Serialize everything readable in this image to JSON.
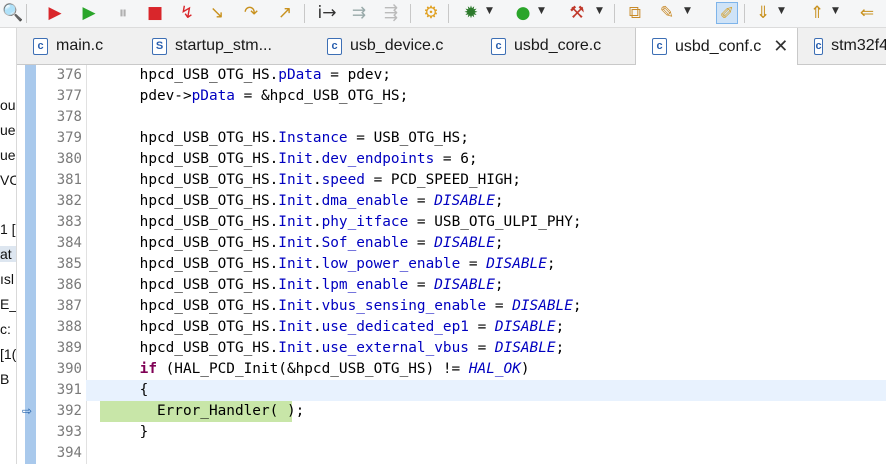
{
  "toolbar": {
    "icons": [
      "search-icon",
      "debug-red-icon",
      "resume-icon",
      "suspend-icon",
      "terminate-icon",
      "disconnect-icon",
      "step-into-icon",
      "step-over-icon",
      "step-return-icon",
      "instruction-step-icon",
      "use-step-filters-icon",
      "skip-breakpoints-icon",
      "build-icon",
      "debug-icon",
      "run-icon",
      "external-tools-icon",
      "open-type-icon",
      "search-tool-icon",
      "toggle-mark-icon",
      "next-annotation-icon",
      "prev-annotation-icon"
    ],
    "colors": {
      "run": "#2aa52a",
      "terminate": "#d9262b",
      "debug": "#2c7a2c"
    }
  },
  "left_strip": {
    "fragments": [
      {
        "text": "ou",
        "selected": false
      },
      {
        "text": "ue",
        "selected": false
      },
      {
        "text": "ue",
        "selected": false
      },
      {
        "text": "VC",
        "selected": false
      },
      {
        "text": "1 [",
        "selected": false
      },
      {
        "text": "at",
        "selected": true
      },
      {
        "text": "ısl",
        "selected": false
      },
      {
        "text": "E_",
        "selected": false
      },
      {
        "text": "c:",
        "selected": false
      },
      {
        "text": "[1(",
        "selected": false
      },
      {
        "text": "B",
        "selected": false
      }
    ]
  },
  "tabs": [
    {
      "label": "main.c",
      "icon": "c",
      "active": false
    },
    {
      "label": "startup_stm...",
      "icon": "S",
      "active": false
    },
    {
      "label": "usb_device.c",
      "icon": "c",
      "active": false
    },
    {
      "label": "usbd_core.c",
      "icon": "c",
      "active": false
    },
    {
      "label": "usbd_conf.c",
      "icon": "c",
      "active": true,
      "close": "✕"
    },
    {
      "label": "stm32f4",
      "icon": "c",
      "active": false
    }
  ],
  "editor": {
    "lines": [
      {
        "n": "376",
        "tokens": [
          [
            "",
            "    hpcd_USB_OTG_HS."
          ],
          [
            "fld",
            "pData"
          ],
          [
            "",
            " = pdev;"
          ]
        ]
      },
      {
        "n": "377",
        "tokens": [
          [
            "",
            "    pdev->"
          ],
          [
            "fld",
            "pData"
          ],
          [
            "",
            " = &hpcd_USB_OTG_HS;"
          ]
        ]
      },
      {
        "n": "378",
        "tokens": []
      },
      {
        "n": "379",
        "tokens": [
          [
            "",
            "    hpcd_USB_OTG_HS."
          ],
          [
            "fld",
            "Instance"
          ],
          [
            "",
            " = USB_OTG_HS;"
          ]
        ]
      },
      {
        "n": "380",
        "tokens": [
          [
            "",
            "    hpcd_USB_OTG_HS."
          ],
          [
            "fld",
            "Init"
          ],
          [
            "",
            "."
          ],
          [
            "fld",
            "dev_endpoints"
          ],
          [
            "",
            " = 6;"
          ]
        ]
      },
      {
        "n": "381",
        "tokens": [
          [
            "",
            "    hpcd_USB_OTG_HS."
          ],
          [
            "fld",
            "Init"
          ],
          [
            "",
            "."
          ],
          [
            "fld",
            "speed"
          ],
          [
            "",
            " = PCD_SPEED_HIGH;"
          ]
        ]
      },
      {
        "n": "382",
        "tokens": [
          [
            "",
            "    hpcd_USB_OTG_HS."
          ],
          [
            "fld",
            "Init"
          ],
          [
            "",
            "."
          ],
          [
            "fld",
            "dma_enable"
          ],
          [
            "",
            " = "
          ],
          [
            "mac",
            "DISABLE"
          ],
          [
            "",
            ";"
          ]
        ]
      },
      {
        "n": "383",
        "tokens": [
          [
            "",
            "    hpcd_USB_OTG_HS."
          ],
          [
            "fld",
            "Init"
          ],
          [
            "",
            "."
          ],
          [
            "fld",
            "phy_itface"
          ],
          [
            "",
            " = USB_OTG_ULPI_PHY;"
          ]
        ]
      },
      {
        "n": "384",
        "tokens": [
          [
            "",
            "    hpcd_USB_OTG_HS."
          ],
          [
            "fld",
            "Init"
          ],
          [
            "",
            "."
          ],
          [
            "fld",
            "Sof_enable"
          ],
          [
            "",
            " = "
          ],
          [
            "mac",
            "DISABLE"
          ],
          [
            "",
            ";"
          ]
        ]
      },
      {
        "n": "385",
        "tokens": [
          [
            "",
            "    hpcd_USB_OTG_HS."
          ],
          [
            "fld",
            "Init"
          ],
          [
            "",
            "."
          ],
          [
            "fld",
            "low_power_enable"
          ],
          [
            "",
            " = "
          ],
          [
            "mac",
            "DISABLE"
          ],
          [
            "",
            ";"
          ]
        ]
      },
      {
        "n": "386",
        "tokens": [
          [
            "",
            "    hpcd_USB_OTG_HS."
          ],
          [
            "fld",
            "Init"
          ],
          [
            "",
            "."
          ],
          [
            "fld",
            "lpm_enable"
          ],
          [
            "",
            " = "
          ],
          [
            "mac",
            "DISABLE"
          ],
          [
            "",
            ";"
          ]
        ]
      },
      {
        "n": "387",
        "tokens": [
          [
            "",
            "    hpcd_USB_OTG_HS."
          ],
          [
            "fld",
            "Init"
          ],
          [
            "",
            "."
          ],
          [
            "fld",
            "vbus_sensing_enable"
          ],
          [
            "",
            " = "
          ],
          [
            "mac",
            "DISABLE"
          ],
          [
            "",
            ";"
          ]
        ]
      },
      {
        "n": "388",
        "tokens": [
          [
            "",
            "    hpcd_USB_OTG_HS."
          ],
          [
            "fld",
            "Init"
          ],
          [
            "",
            "."
          ],
          [
            "fld",
            "use_dedicated_ep1"
          ],
          [
            "",
            " = "
          ],
          [
            "mac",
            "DISABLE"
          ],
          [
            "",
            ";"
          ]
        ]
      },
      {
        "n": "389",
        "tokens": [
          [
            "",
            "    hpcd_USB_OTG_HS."
          ],
          [
            "fld",
            "Init"
          ],
          [
            "",
            "."
          ],
          [
            "fld",
            "use_external_vbus"
          ],
          [
            "",
            " = "
          ],
          [
            "mac",
            "DISABLE"
          ],
          [
            "",
            ";"
          ]
        ]
      },
      {
        "n": "390",
        "tokens": [
          [
            "kw",
            "    if"
          ],
          [
            "",
            " (HAL_PCD_Init(&hpcd_USB_OTG_HS) != "
          ],
          [
            "mac",
            "HAL_OK"
          ],
          [
            "",
            ")"
          ]
        ]
      },
      {
        "n": "391",
        "tokens": [
          [
            "",
            "    {"
          ]
        ],
        "current": true
      },
      {
        "n": "392",
        "tokens": [
          [
            "",
            "      Error_Handler( );"
          ]
        ],
        "highlight": true,
        "marker": true
      },
      {
        "n": "393",
        "tokens": [
          [
            "",
            "    }"
          ]
        ]
      },
      {
        "n": "394",
        "tokens": []
      }
    ],
    "colors": {
      "keyword": "#7f0055",
      "field": "#0000c0",
      "highlight": "#c8e6a8",
      "ruler": "#a9c9ec"
    }
  }
}
